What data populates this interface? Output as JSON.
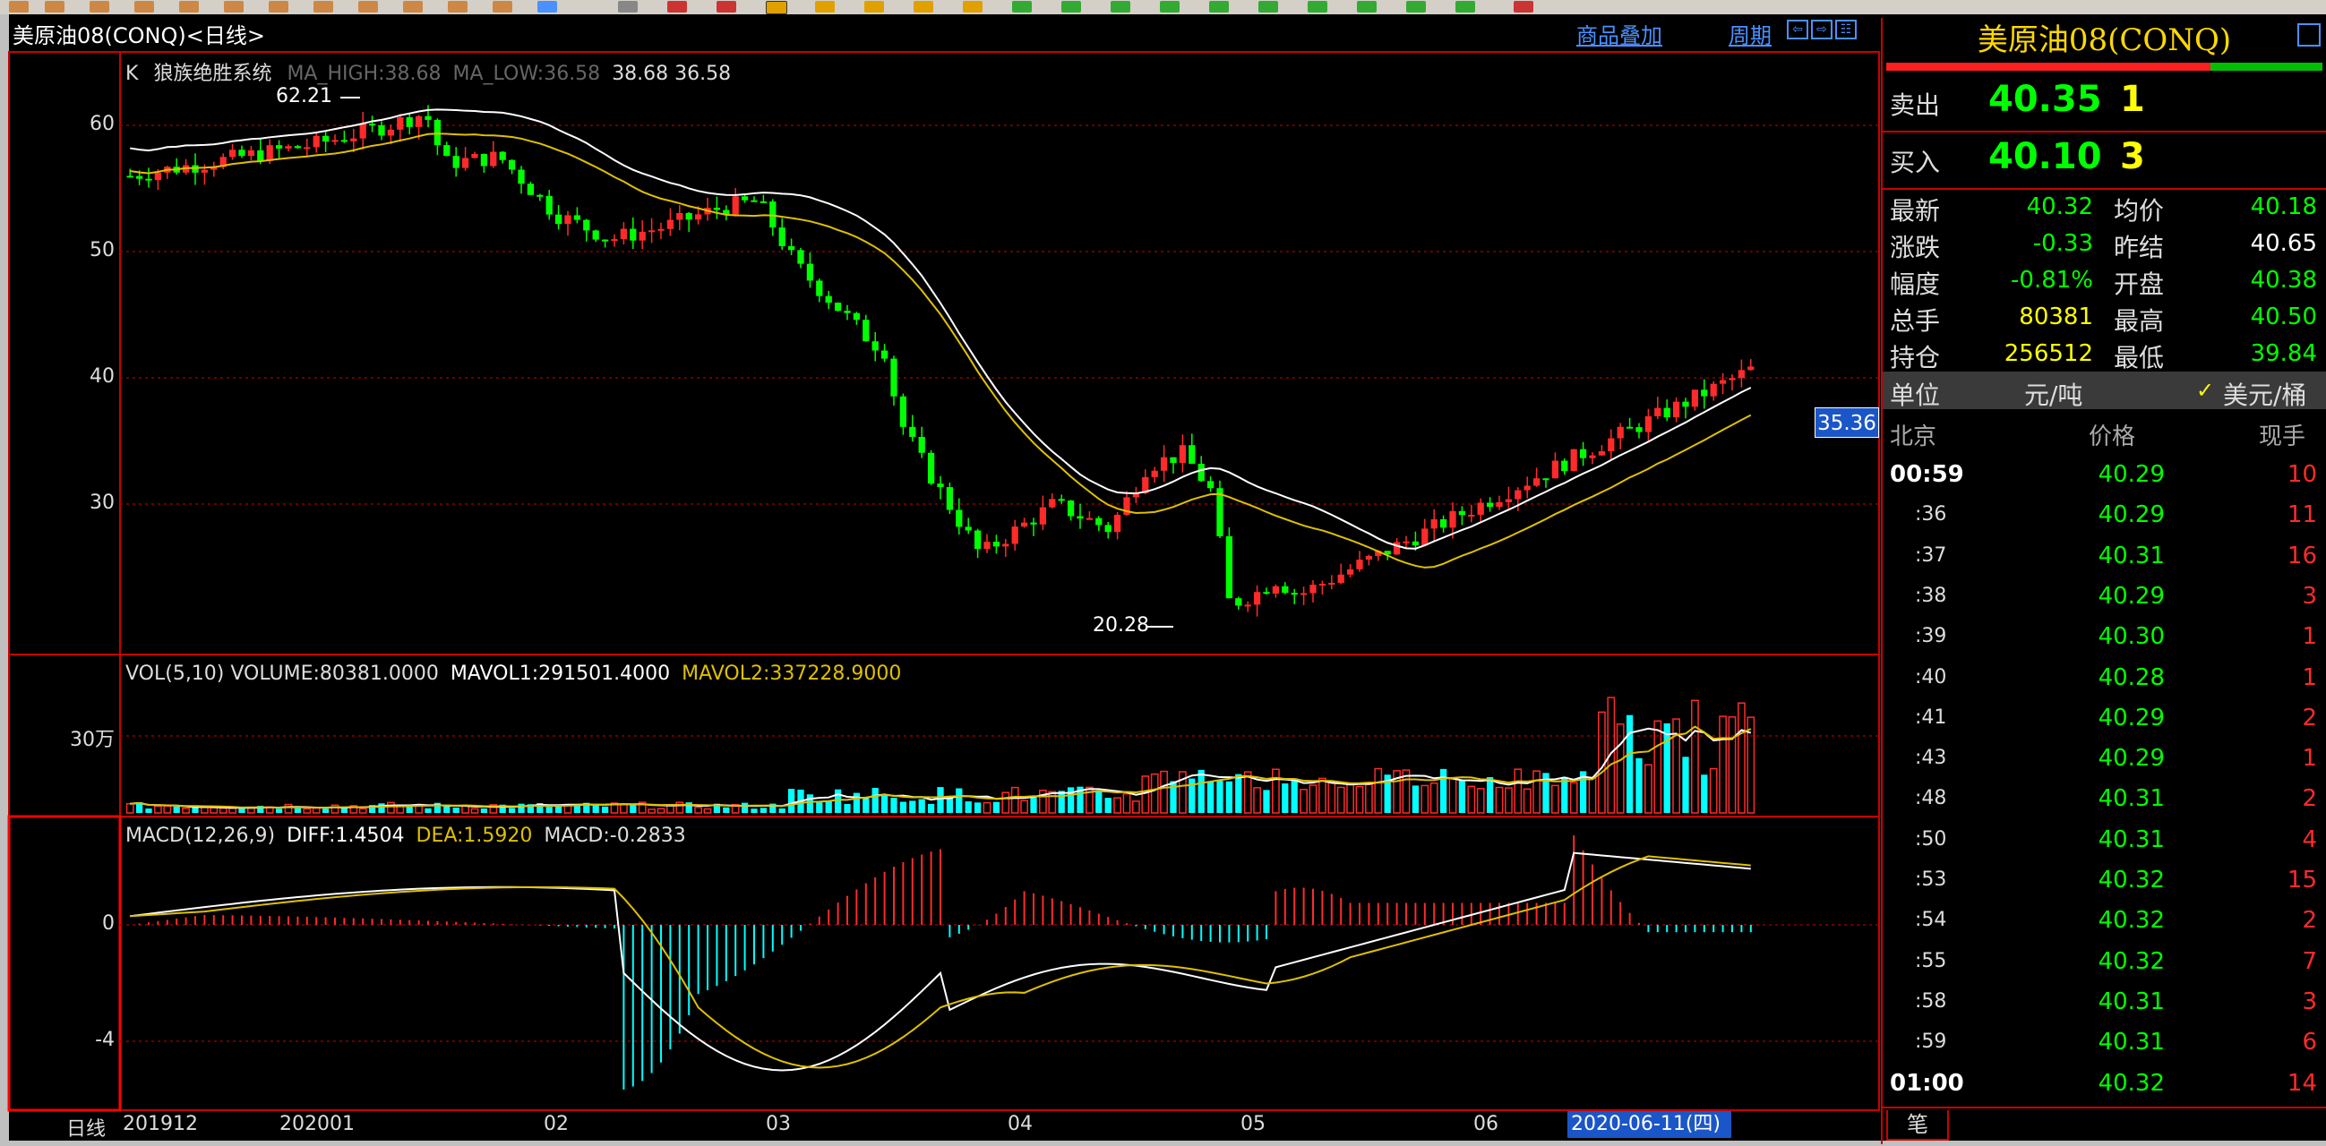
{
  "window": {
    "title": "美原油08(CONQ)<日线>",
    "links": [
      "商品叠加",
      "周期"
    ]
  },
  "main_chart": {
    "indicator_legend": {
      "prefix": "K",
      "system": "狼族绝胜系统",
      "ma_high": "MA_HIGH:38.68",
      "ma_low": "MA_LOW:36.58",
      "values": "38.68 36.58"
    },
    "y_ticks": [
      "60",
      "50",
      "40",
      "30"
    ],
    "high_marker": "62.21",
    "low_marker": "20.28",
    "price_tag": "35.36"
  },
  "volume_chart": {
    "legend_main": "VOL(5,10) VOLUME:80381.0000",
    "legend_mavol1": "MAVOL1:291501.4000",
    "legend_mavol2": "MAVOL2:337228.9000",
    "y_tick": "30万"
  },
  "macd_chart": {
    "legend_main": "MACD(12,26,9)",
    "legend_diff": "DIFF:1.4504",
    "legend_dea": "DEA:1.5920",
    "legend_macd": "MACD:-0.2833",
    "y_ticks": [
      "0",
      "-4"
    ]
  },
  "x_axis": {
    "period_label": "日线",
    "ticks": [
      "201912",
      "202001",
      "02",
      "03",
      "04",
      "05",
      "06"
    ],
    "cursor_date": "2020-06-11(四)"
  },
  "quote_panel": {
    "instrument": "美原油08(CONQ)",
    "sell": {
      "label": "卖出",
      "price": "40.35",
      "qty": "1"
    },
    "buy": {
      "label": "买入",
      "price": "40.10",
      "qty": "3"
    },
    "stats": [
      {
        "label": "最新",
        "value": "40.32",
        "label2": "均价",
        "value2": "40.18"
      },
      {
        "label": "涨跌",
        "value": "-0.33",
        "label2": "昨结",
        "value2": "40.65"
      },
      {
        "label": "幅度",
        "value": "-0.81%",
        "label2": "开盘",
        "value2": "40.38"
      },
      {
        "label": "总手",
        "value": "80381",
        "label2": "最高",
        "value2": "40.50"
      },
      {
        "label": "持仓",
        "value": "256512",
        "label2": "最低",
        "value2": "39.84"
      }
    ],
    "unit": {
      "label": "单位",
      "cny": "元/吨",
      "usd": "美元/桶",
      "check": "✓"
    },
    "ticks_header": {
      "time": "北京",
      "price": "价格",
      "vol": "现手"
    },
    "ticks": [
      {
        "time": "00:59",
        "price": "40.29",
        "vol": "10"
      },
      {
        "time": ":36",
        "price": "40.29",
        "vol": "11"
      },
      {
        "time": ":37",
        "price": "40.31",
        "vol": "16"
      },
      {
        "time": ":38",
        "price": "40.29",
        "vol": "3"
      },
      {
        "time": ":39",
        "price": "40.30",
        "vol": "1"
      },
      {
        "time": ":40",
        "price": "40.28",
        "vol": "1"
      },
      {
        "time": ":41",
        "price": "40.29",
        "vol": "2"
      },
      {
        "time": ":43",
        "price": "40.29",
        "vol": "1"
      },
      {
        "time": ":48",
        "price": "40.31",
        "vol": "2"
      },
      {
        "time": ":50",
        "price": "40.31",
        "vol": "4"
      },
      {
        "time": ":53",
        "price": "40.32",
        "vol": "15"
      },
      {
        "time": ":54",
        "price": "40.32",
        "vol": "2"
      },
      {
        "time": ":55",
        "price": "40.32",
        "vol": "7"
      },
      {
        "time": ":58",
        "price": "40.31",
        "vol": "3"
      },
      {
        "time": ":59",
        "price": "40.31",
        "vol": "6"
      },
      {
        "time": "01:00",
        "price": "40.32",
        "vol": "14"
      }
    ],
    "bottom_tab": "笔"
  },
  "colors": {
    "up": "#ff2a2a",
    "down_price": "#00ff00",
    "down_volume": "#00ffff",
    "ma_high": "#ffffff",
    "ma_low": "#e0c000",
    "grid": "#8b0000",
    "accent": "#1a56c8"
  }
}
